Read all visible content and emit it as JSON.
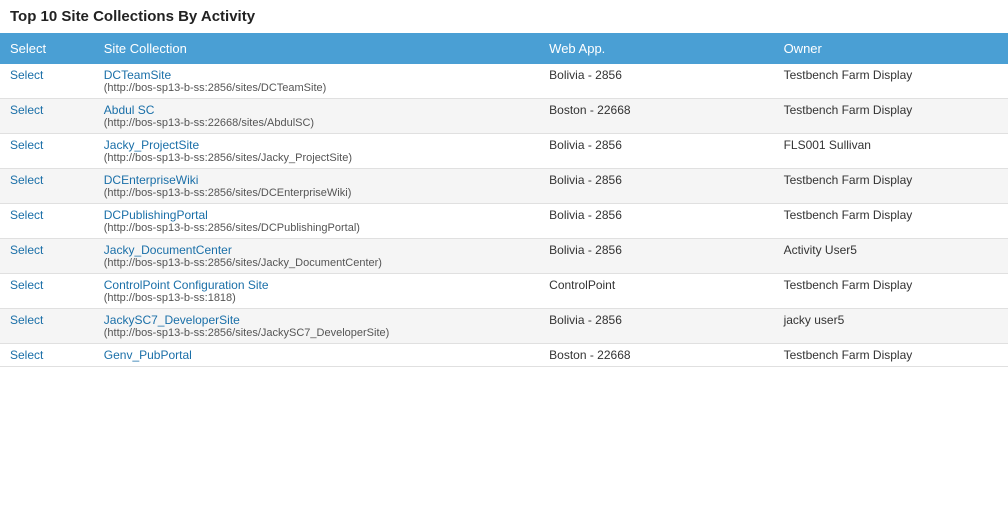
{
  "title": "Top 10 Site Collections By Activity",
  "columns": [
    "Select",
    "Site Collection",
    "Web App.",
    "Owner"
  ],
  "rows": [
    {
      "select": "Select",
      "site_name": "DCTeamSite",
      "site_url": "http://bos-sp13-b-ss:2856/sites/DCTeamSite",
      "webapp": "Bolivia - 2856",
      "owner": "Testbench Farm Display"
    },
    {
      "select": "Select",
      "site_name": "Abdul SC",
      "site_url": "http://bos-sp13-b-ss:22668/sites/AbdulSC",
      "webapp": "Boston - 22668",
      "owner": "Testbench Farm Display"
    },
    {
      "select": "Select",
      "site_name": "Jacky_ProjectSite",
      "site_url": "http://bos-sp13-b-ss:2856/sites/Jacky_ProjectSite",
      "webapp": "Bolivia - 2856",
      "owner": "FLS001 Sullivan"
    },
    {
      "select": "Select",
      "site_name": "DCEnterpriseWiki",
      "site_url": "http://bos-sp13-b-ss:2856/sites/DCEnterpriseWiki",
      "webapp": "Bolivia - 2856",
      "owner": "Testbench Farm Display"
    },
    {
      "select": "Select",
      "site_name": "DCPublishingPortal",
      "site_url": "http://bos-sp13-b-ss:2856/sites/DCPublishingPortal",
      "webapp": "Bolivia - 2856",
      "owner": "Testbench Farm Display"
    },
    {
      "select": "Select",
      "site_name": "Jacky_DocumentCenter",
      "site_url": "http://bos-sp13-b-ss:2856/sites/Jacky_DocumentCenter",
      "webapp": "Bolivia - 2856",
      "owner": "Activity User5"
    },
    {
      "select": "Select",
      "site_name": "ControlPoint Configuration Site",
      "site_url": "http://bos-sp13-b-ss:1818",
      "webapp": "ControlPoint",
      "owner": "Testbench Farm Display"
    },
    {
      "select": "Select",
      "site_name": "JackySC7_DeveloperSite",
      "site_url": "http://bos-sp13-b-ss:2856/sites/JackySC7_DeveloperSite",
      "webapp": "Bolivia - 2856",
      "owner": "jacky user5"
    },
    {
      "select": "Select",
      "site_name": "Genv_PubPortal",
      "site_url": "",
      "webapp": "Boston - 22668",
      "owner": "Testbench Farm Display"
    }
  ]
}
